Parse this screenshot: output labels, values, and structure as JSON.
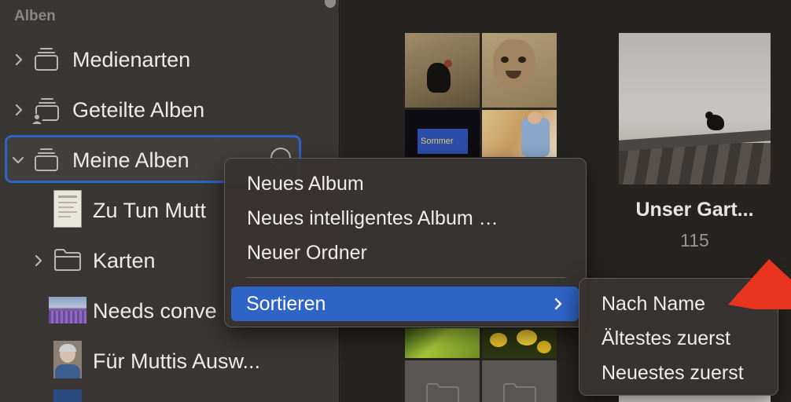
{
  "sidebar": {
    "section_header": "Alben",
    "items": [
      {
        "label": "Medienarten"
      },
      {
        "label": "Geteilte Alben"
      },
      {
        "label": "Meine Alben"
      },
      {
        "label": "Zu Tun Mutt"
      },
      {
        "label": "Karten"
      },
      {
        "label": "Needs conve"
      },
      {
        "label": "Für Muttis Ausw..."
      }
    ]
  },
  "context_menu": {
    "items": [
      "Neues Album",
      "Neues intelligentes Album …",
      "Neuer Ordner"
    ],
    "highlighted": "Sortieren"
  },
  "submenu": {
    "items": [
      "Nach Name",
      "Ältestes zuerst",
      "Neuestes zuerst"
    ]
  },
  "album": {
    "title": "Unser Gart...",
    "count": "115"
  },
  "thumb_text": "Sommer",
  "colors": {
    "accent": "#2f64c7",
    "annotation_arrow": "#e8331f"
  }
}
